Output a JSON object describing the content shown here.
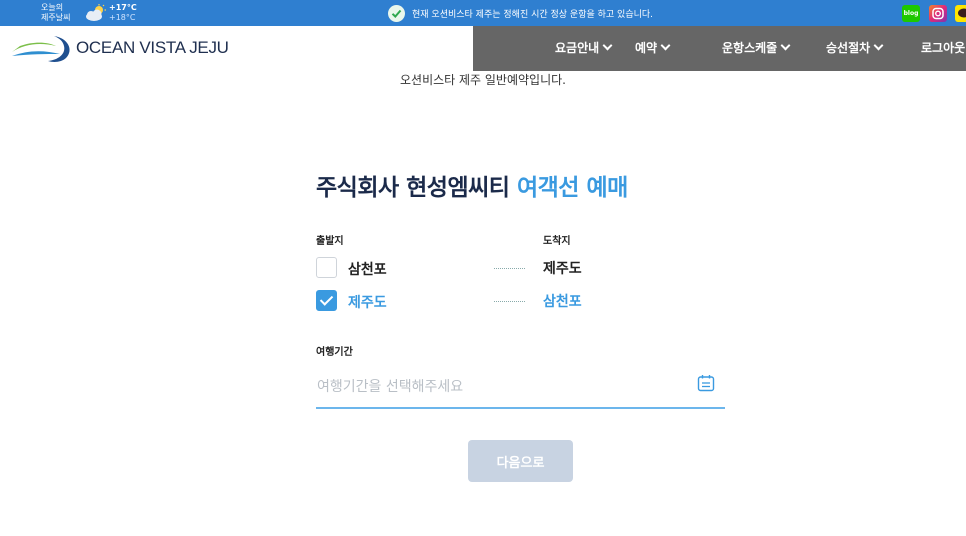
{
  "topbar": {
    "weather_label": "오늘의\n제주날씨",
    "temp_high": "+17°C",
    "temp_low": "+18°C",
    "weather_icon": "partly-cloudy-icon",
    "notice": "현재 오션비스타 제주는 정해진 시간 정상 운항을 하고 있습니다.",
    "social": [
      {
        "name": "blog",
        "label": "blog",
        "color": "#1ec800"
      },
      {
        "name": "instagram",
        "color": "#dd2a7b"
      },
      {
        "name": "kakao",
        "color": "#fee500"
      }
    ]
  },
  "header": {
    "logo_text": "OCEAN VISTA JEJU",
    "nav": [
      {
        "label": "요금안내"
      },
      {
        "label": "예약"
      },
      {
        "label": "운항스케줄"
      },
      {
        "label": "승선절차"
      },
      {
        "label": "로그아웃"
      }
    ],
    "nav_bg": "#666666"
  },
  "main": {
    "subtitle": "오션비스타 제주 일반예약입니다.",
    "title_main": "주식회사 현성엠씨티 ",
    "title_accent": "여객선 예매",
    "departure_label": "출발지",
    "arrival_label": "도착지",
    "routes": [
      {
        "from": "삼천포",
        "to": "제주도",
        "checked": false
      },
      {
        "from": "제주도",
        "to": "삼천포",
        "checked": true
      }
    ],
    "period_label": "여행기간",
    "period_placeholder": "여행기간을 선택해주세요",
    "period_value": "",
    "next_button": "다음으로"
  },
  "colors": {
    "topbar": "#2f7fd0",
    "accent": "#3a9ae0",
    "title": "#1b2a4a",
    "button_disabled": "#c8d3e2"
  }
}
